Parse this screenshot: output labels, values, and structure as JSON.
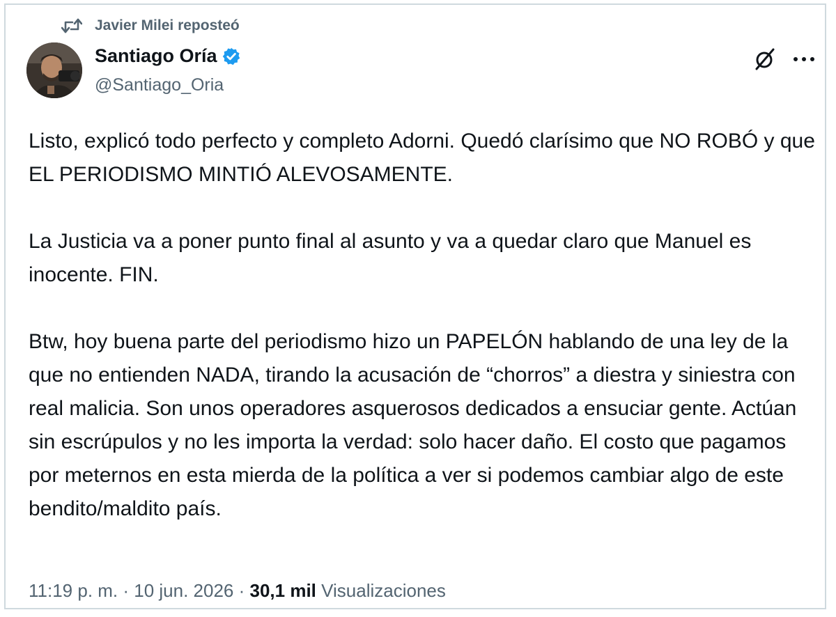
{
  "repost": {
    "label": "Javier Milei reposteó"
  },
  "author": {
    "display_name": "Santiago Oría",
    "handle": "@Santiago_Oria",
    "verified": true,
    "verified_color": "#1d9bf0"
  },
  "header_icons": {
    "grok": "grok-icon",
    "more": "more-options-icon"
  },
  "tweet": {
    "paragraphs": [
      "Listo, explicó todo perfecto y completo Adorni. Quedó clarísimo que NO ROBÓ y que EL PERIODISMO MINTIÓ ALEVOSAMENTE.",
      "La Justicia va a poner punto final al asunto y va a quedar claro que Manuel es inocente. FIN.",
      "Btw, hoy buena parte del periodismo hizo un PAPELÓN hablando de una ley de la que no entienden NADA, tirando la acusación de “chorros” a diestra y siniestra con real malicia. Son unos operadores asquerosos dedicados a ensuciar gente. Actúan sin escrúpulos y no les importa la verdad: solo hacer daño. El costo que pagamos por meternos en esta mierda de la política a ver si podemos cambiar algo de este bendito/maldito país."
    ]
  },
  "meta": {
    "time": "11:19 p. m.",
    "separator": " · ",
    "date": "10 jun. 2026",
    "views_count": "30,1 mil",
    "views_label": "Visualizaciones"
  },
  "colors": {
    "text": "#0f1419",
    "secondary_text": "#536471",
    "border": "#cfd9de"
  }
}
